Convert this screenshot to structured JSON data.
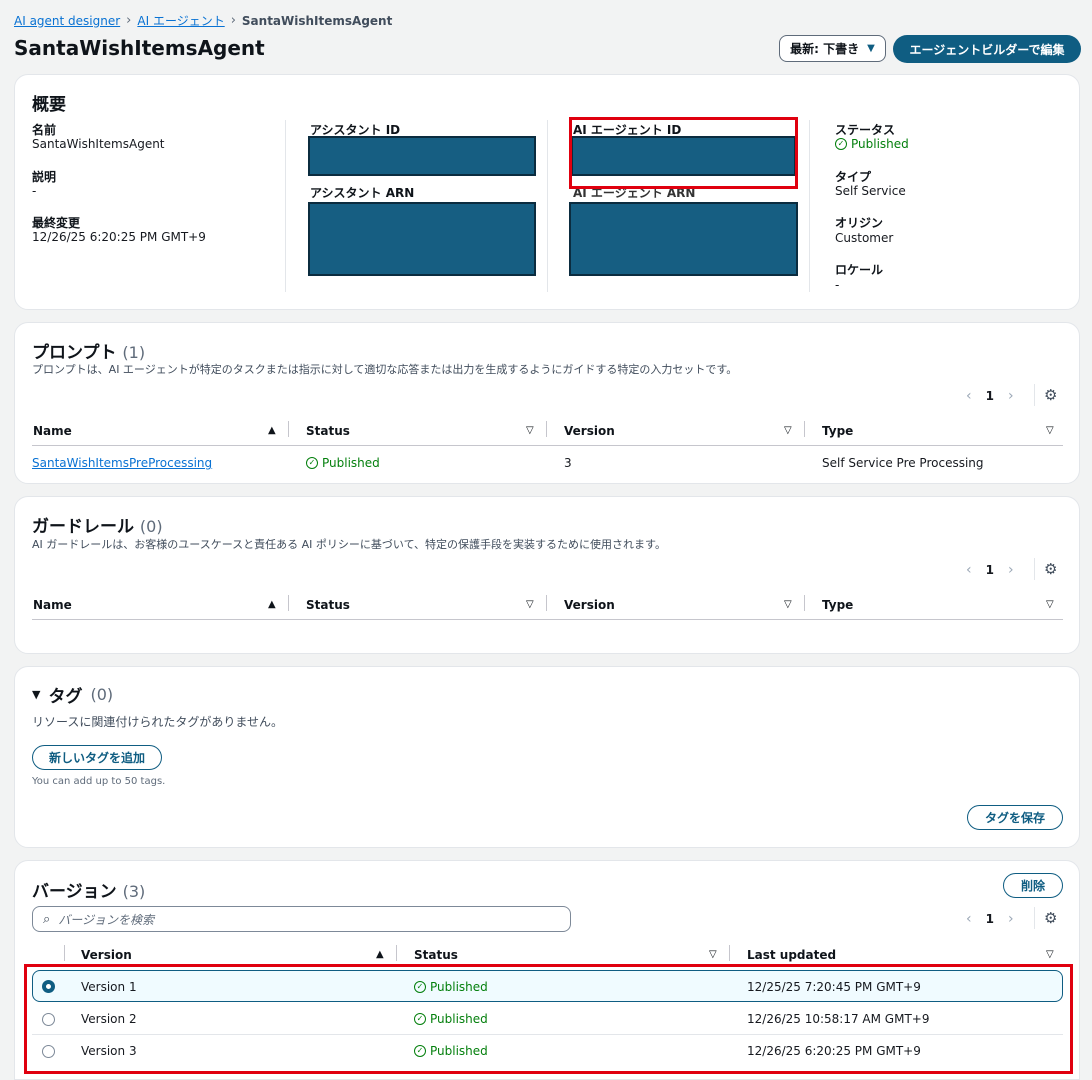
{
  "breadcrumb": {
    "items": [
      "AI agent designer",
      "AI エージェント"
    ],
    "current": "SantaWishItemsAgent"
  },
  "header": {
    "title": "SantaWishItemsAgent",
    "version_select": "最新: 下書き",
    "edit_button": "エージェントビルダーで編集"
  },
  "overview": {
    "title": "概要",
    "name_label": "名前",
    "name_value": "SantaWishItemsAgent",
    "desc_label": "説明",
    "desc_value": "-",
    "modified_label": "最終変更",
    "modified_value": "12/26/25 6:20:25 PM GMT+9",
    "assistant_id_label": "アシスタント ID",
    "assistant_arn_label": "アシスタント ARN",
    "agent_id_label": "AI エージェント ID",
    "agent_arn_label": "AI エージェント ARN",
    "status_label": "ステータス",
    "status_value": "Published",
    "type_label": "タイプ",
    "type_value": "Self Service",
    "origin_label": "オリジン",
    "origin_value": "Customer",
    "locale_label": "ロケール",
    "locale_value": "-"
  },
  "prompts": {
    "title": "プロンプト",
    "count": "(1)",
    "description": "プロンプトは、AI エージェントが特定のタスクまたは指示に対して適切な応答または出力を生成するようにガイドする特定の入力セットです。",
    "page": "1",
    "columns": [
      "Name",
      "Status",
      "Version",
      "Type"
    ],
    "rows": [
      {
        "name": "SantaWishItemsPreProcessing",
        "status": "Published",
        "version": "3",
        "type": "Self Service Pre Processing"
      }
    ]
  },
  "guardrails": {
    "title": "ガードレール",
    "count": "(0)",
    "description": "AI ガードレールは、お客様のユースケースと責任ある AI ポリシーに基づいて、特定の保護手段を実装するために使用されます。",
    "page": "1",
    "columns": [
      "Name",
      "Status",
      "Version",
      "Type"
    ]
  },
  "tags": {
    "title": "タグ",
    "count": "(0)",
    "empty": "リソースに関連付けられたタグがありません。",
    "add_button": "新しいタグを追加",
    "hint": "You can add up to 50 tags.",
    "save_button": "タグを保存"
  },
  "versions": {
    "title": "バージョン",
    "count": "(3)",
    "delete_button": "削除",
    "search_placeholder": "バージョンを検索",
    "page": "1",
    "columns": [
      "Version",
      "Status",
      "Last updated"
    ],
    "rows": [
      {
        "version": "Version 1",
        "status": "Published",
        "updated": "12/25/25 7:20:45 PM GMT+9",
        "selected": true
      },
      {
        "version": "Version 2",
        "status": "Published",
        "updated": "12/26/25 10:58:17 AM GMT+9",
        "selected": false
      },
      {
        "version": "Version 3",
        "status": "Published",
        "updated": "12/26/25 6:20:25 PM GMT+9",
        "selected": false
      }
    ]
  },
  "colors": {
    "primary": "#0f5d82",
    "success": "#037f0c",
    "highlight": "#e0000f",
    "redaction": "#165e82"
  },
  "icons": [
    "chevron-right-icon",
    "caret-down-icon",
    "check-circle-icon",
    "settings-gear-icon",
    "sort-asc-icon",
    "sort-desc-icon",
    "search-icon",
    "radio-icon",
    "chevron-left-icon"
  ]
}
